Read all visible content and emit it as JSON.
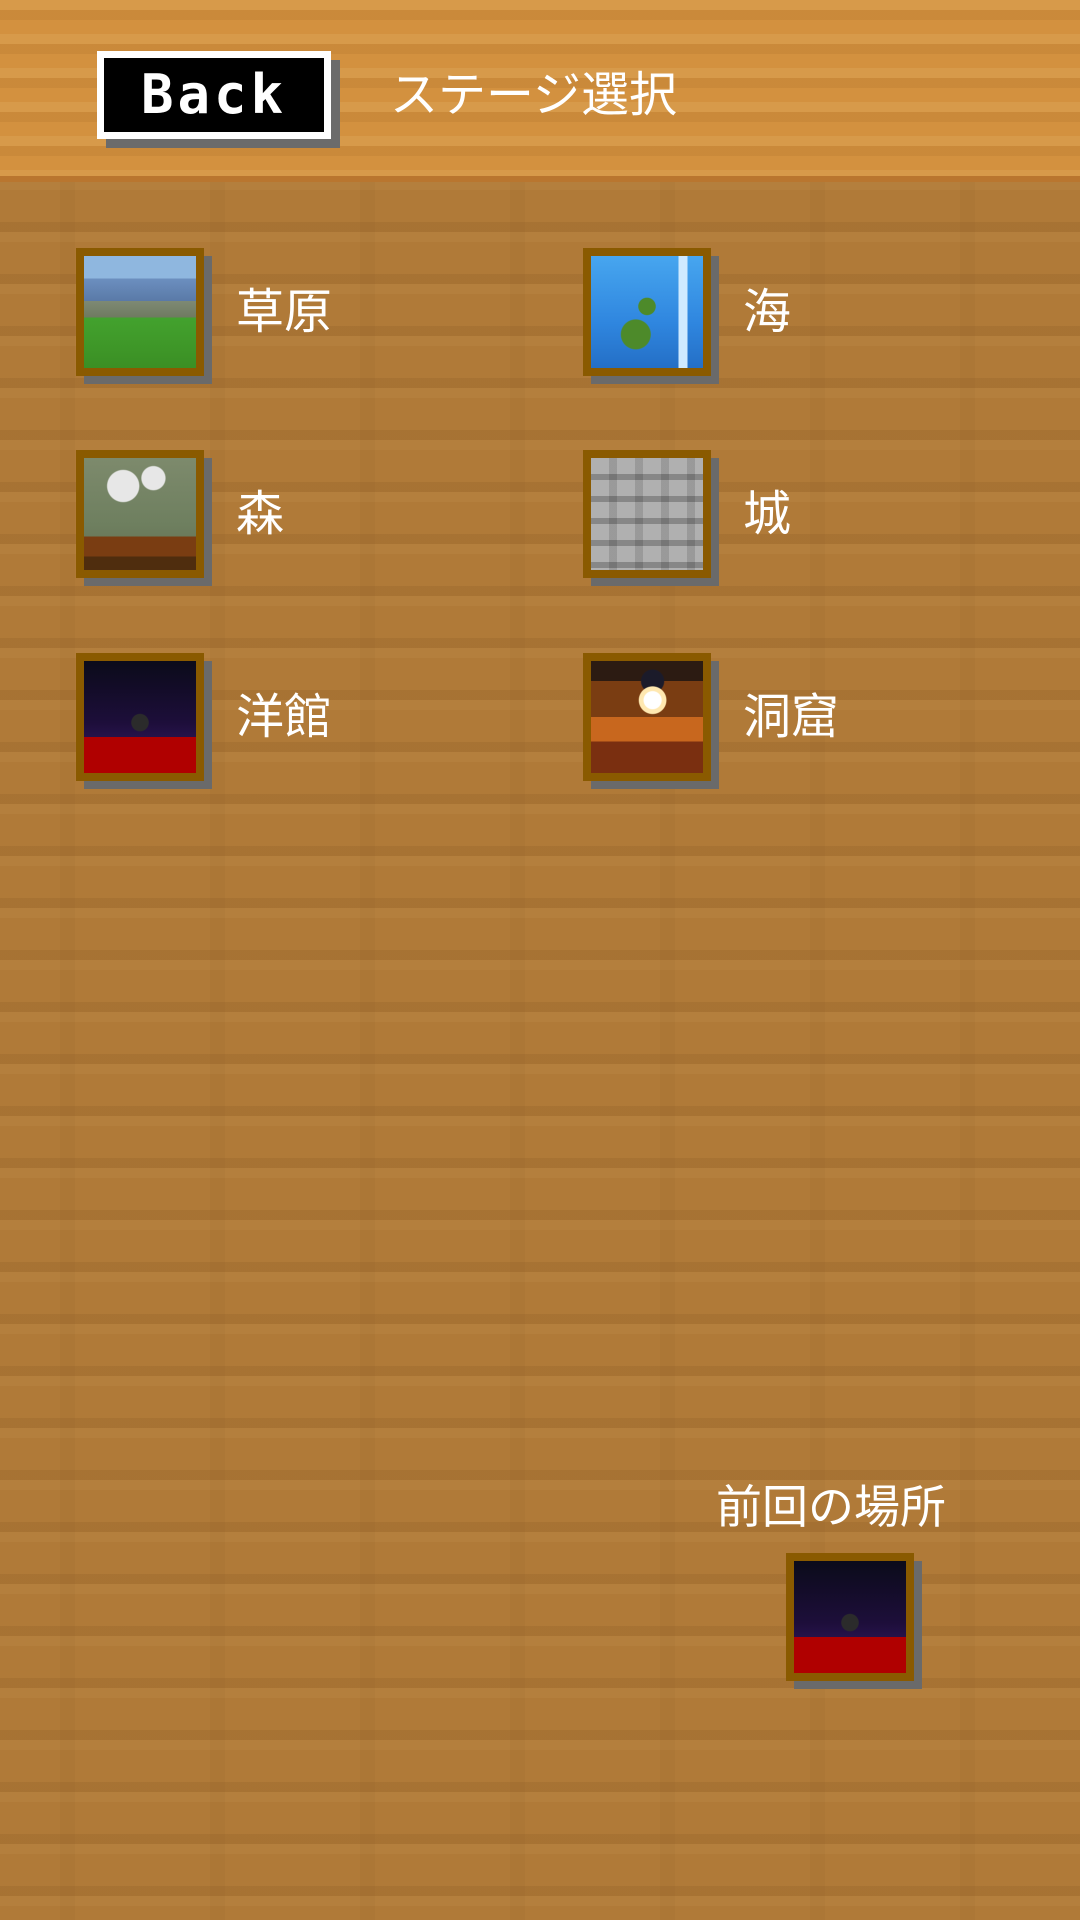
{
  "header": {
    "back_label": "Back",
    "title": "ステージ選択"
  },
  "stages": [
    {
      "label": "草原",
      "icon": "grassland-thumbnail-icon"
    },
    {
      "label": "海",
      "icon": "sea-thumbnail-icon"
    },
    {
      "label": "森",
      "icon": "forest-thumbnail-icon"
    },
    {
      "label": "城",
      "icon": "castle-thumbnail-icon"
    },
    {
      "label": "洋館",
      "icon": "mansion-thumbnail-icon"
    },
    {
      "label": "洞窟",
      "icon": "cave-thumbnail-icon"
    }
  ],
  "previous": {
    "label": "前回の場所",
    "icon": "mansion-thumbnail-icon"
  },
  "colors": {
    "background": "#b07a38",
    "topbar": "#d3913f",
    "frame": "#8a5a00",
    "text": "#ffffff"
  }
}
